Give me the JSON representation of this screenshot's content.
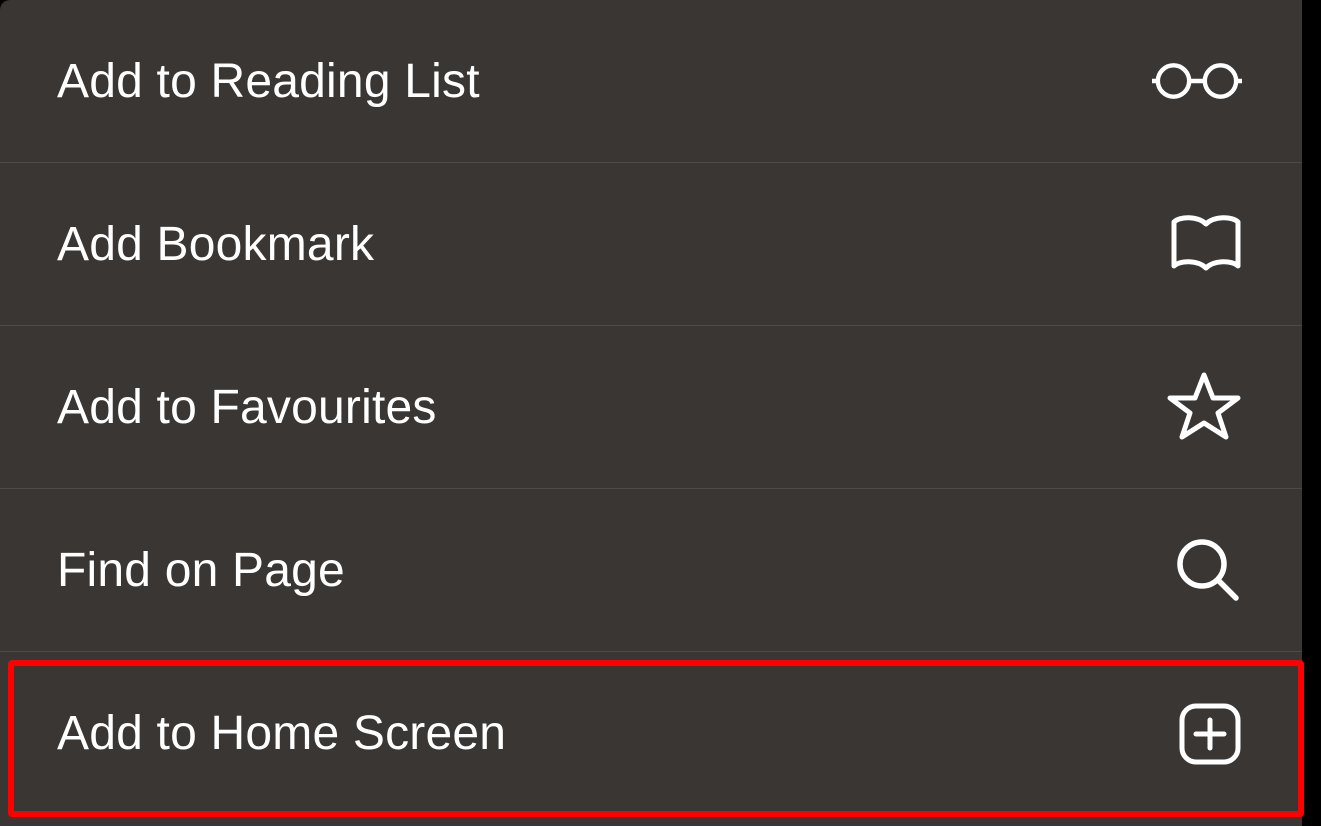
{
  "menu": {
    "items": [
      {
        "label": "Add to Reading List",
        "icon": "glasses-icon"
      },
      {
        "label": "Add Bookmark",
        "icon": "book-icon"
      },
      {
        "label": "Add to Favourites",
        "icon": "star-icon"
      },
      {
        "label": "Find on Page",
        "icon": "search-icon"
      },
      {
        "label": "Add to Home Screen",
        "icon": "plus-square-icon"
      }
    ]
  },
  "annotation": {
    "highlight_index": 4,
    "highlight_color": "#ff0000"
  },
  "colors": {
    "background": "#3a3633",
    "text": "#ffffff",
    "separator": "rgba(255,255,255,0.10)"
  }
}
